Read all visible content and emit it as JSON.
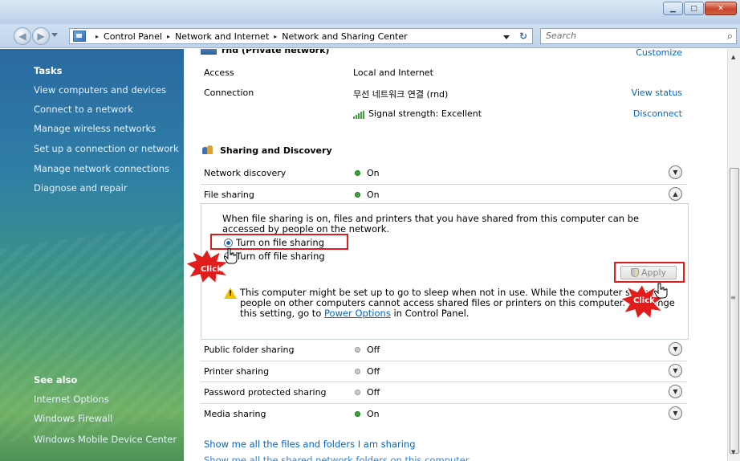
{
  "window": {
    "minimize_glyph": "▁",
    "maximize_glyph": "□",
    "close_glyph": "✕"
  },
  "address": {
    "crumbs": [
      "Control Panel",
      "Network and Internet",
      "Network and Sharing Center"
    ],
    "separator": "▸",
    "search_placeholder": "Search",
    "refresh_glyph": "↻",
    "search_icon": "⌕"
  },
  "sidebar": {
    "tasks_title": "Tasks",
    "tasks": [
      "View computers and devices",
      "Connect to a network",
      "Manage wireless networks",
      "Set up a connection or network",
      "Manage network connections",
      "Diagnose and repair"
    ],
    "see_also_title": "See also",
    "see_also": [
      "Internet Options",
      "Windows Firewall",
      "Windows Mobile Device Center"
    ]
  },
  "network": {
    "name_partial": "rnd (Private network)",
    "customize": "Customize",
    "access_label": "Access",
    "access_value": "Local and Internet",
    "connection_label": "Connection",
    "connection_value": "무선 네트워크 연결 (rnd)",
    "view_status": "View status",
    "signal_text": "Signal strength:  Excellent",
    "disconnect": "Disconnect"
  },
  "sharing": {
    "title": "Sharing and Discovery",
    "rows": [
      {
        "label": "Network discovery",
        "status": "On"
      },
      {
        "label": "File sharing",
        "status": "On"
      }
    ],
    "description": "When file sharing is on, files and printers that you have shared from this computer can be accessed by people on the network.",
    "option_on": "Turn on file sharing",
    "option_off": "Turn off file sharing",
    "apply": "Apply",
    "warning_part1": "This computer might be set up to go to sleep when not in use. While the computer sleeps, people on other computers cannot access shared files or printers on this computer. To change this setting, go to ",
    "warning_link": "Power Options",
    "warning_part2": " in Control Panel.",
    "more_rows": [
      {
        "label": "Public folder sharing",
        "status": "Off"
      },
      {
        "label": "Printer sharing",
        "status": "Off"
      },
      {
        "label": "Password protected sharing",
        "status": "Off"
      },
      {
        "label": "Media sharing",
        "status": "On"
      }
    ],
    "show_files_link": "Show me all the files and folders I am sharing",
    "show_folders_link": "Show me all the shared network folders on this computer"
  },
  "callouts": {
    "click_label": "Click"
  },
  "colors": {
    "highlight": "#e21b1b",
    "link": "#0066cc",
    "status_on": "#3ca33c"
  }
}
